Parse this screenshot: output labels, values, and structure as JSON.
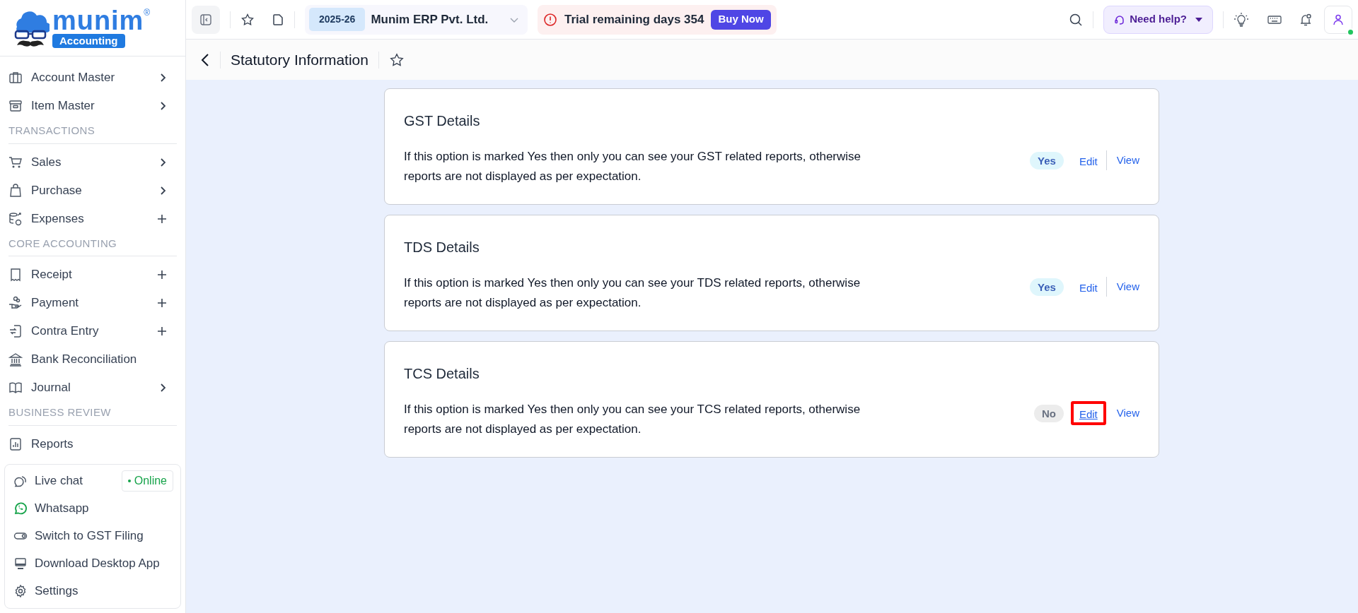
{
  "brand": {
    "name": "munim",
    "registered": "®",
    "tagline": "Accounting"
  },
  "sidebar": {
    "sections": [
      {
        "items": [
          {
            "label": "Account Master",
            "kind": "submenu"
          },
          {
            "label": "Item Master",
            "kind": "submenu"
          }
        ]
      },
      {
        "heading": "TRANSACTIONS",
        "items": [
          {
            "label": "Sales",
            "kind": "submenu"
          },
          {
            "label": "Purchase",
            "kind": "submenu"
          },
          {
            "label": "Expenses",
            "kind": "add"
          }
        ]
      },
      {
        "heading": "CORE ACCOUNTING",
        "items": [
          {
            "label": "Receipt",
            "kind": "add"
          },
          {
            "label": "Payment",
            "kind": "add"
          },
          {
            "label": "Contra Entry",
            "kind": "add"
          },
          {
            "label": "Bank Reconciliation",
            "kind": "link"
          },
          {
            "label": "Journal",
            "kind": "submenu"
          }
        ]
      },
      {
        "heading": "BUSINESS REVIEW",
        "items": [
          {
            "label": "Reports",
            "kind": "link"
          }
        ]
      }
    ],
    "support": [
      {
        "label": "Live chat",
        "badge": "Online"
      },
      {
        "label": "Whatsapp"
      },
      {
        "label": "Switch to GST Filing"
      },
      {
        "label": "Download Desktop App"
      },
      {
        "label": "Settings"
      }
    ]
  },
  "topbar": {
    "year": "2025-26",
    "company": "Munim ERP Pvt. Ltd.",
    "trial": "Trial remaining days 354",
    "buy_button": "Buy Now",
    "help": "Need help?",
    "online": true
  },
  "page": {
    "title": "Statutory Information"
  },
  "cards": [
    {
      "title": "GST Details",
      "description": "If this option is marked Yes then only you can see your GST related reports, otherwise reports are not displayed as per expectation.",
      "status": {
        "label": "Yes",
        "on": true
      },
      "edit": {
        "label": "Edit",
        "highlighted": false
      },
      "view": "View"
    },
    {
      "title": "TDS Details",
      "description": "If this option is marked Yes then only you can see your TDS related reports, otherwise reports are not displayed as per expectation.",
      "status": {
        "label": "Yes",
        "on": true
      },
      "edit": {
        "label": "Edit",
        "highlighted": false
      },
      "view": "View"
    },
    {
      "title": "TCS Details",
      "description": "If this option is marked Yes then only you can see your TCS related reports, otherwise reports are not displayed as per expectation.",
      "status": {
        "label": "No",
        "on": false
      },
      "edit": {
        "label": "Edit",
        "highlighted": true
      },
      "view": "View"
    }
  ]
}
